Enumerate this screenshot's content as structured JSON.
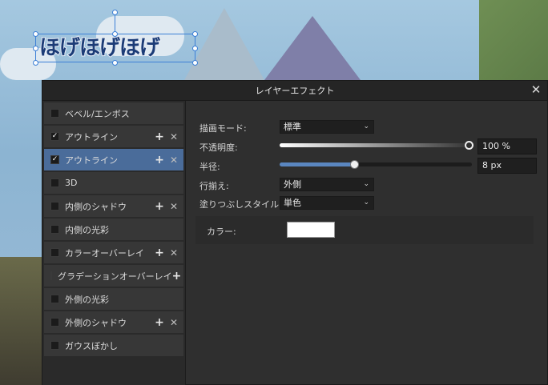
{
  "canvas": {
    "text_object": "ほげほげほげ"
  },
  "dialog": {
    "title": "レイヤーエフェクト",
    "close_icon": "close-icon",
    "effects": [
      {
        "label": "ベベル/エンボス",
        "checked": false,
        "has_actions": false,
        "selected": false
      },
      {
        "label": "アウトライン",
        "checked": true,
        "has_actions": true,
        "selected": false
      },
      {
        "label": "アウトライン",
        "checked": true,
        "has_actions": true,
        "selected": true
      },
      {
        "label": "3D",
        "checked": false,
        "has_actions": false,
        "selected": false
      },
      {
        "label": "内側のシャドウ",
        "checked": false,
        "has_actions": true,
        "selected": false
      },
      {
        "label": "内側の光彩",
        "checked": false,
        "has_actions": false,
        "selected": false
      },
      {
        "label": "カラーオーバーレイ",
        "checked": false,
        "has_actions": true,
        "selected": false
      },
      {
        "label": "グラデーションオーバーレイ",
        "checked": false,
        "has_actions": true,
        "selected": false
      },
      {
        "label": "外側の光彩",
        "checked": false,
        "has_actions": false,
        "selected": false
      },
      {
        "label": "外側のシャドウ",
        "checked": false,
        "has_actions": true,
        "selected": false
      },
      {
        "label": "ガウスぼかし",
        "checked": false,
        "has_actions": false,
        "selected": false
      }
    ],
    "action_icons": {
      "add": "+",
      "remove": "✕"
    },
    "settings": {
      "blend_mode_label": "描画モード:",
      "blend_mode_value": "標準",
      "opacity_label": "不透明度:",
      "opacity_value": "100 %",
      "opacity_fraction": 1.0,
      "radius_label": "半径:",
      "radius_value": "8 px",
      "radius_fraction": 0.38,
      "align_label": "行揃え:",
      "align_value": "外側",
      "fill_style_label": "塗りつぶしスタイル:",
      "fill_style_value": "単色",
      "color_label": "カラー:",
      "color_value": "#ffffff"
    }
  },
  "colors": {
    "selection_accent": "#4a6c9a",
    "handle_blue": "#3c7fd6"
  }
}
